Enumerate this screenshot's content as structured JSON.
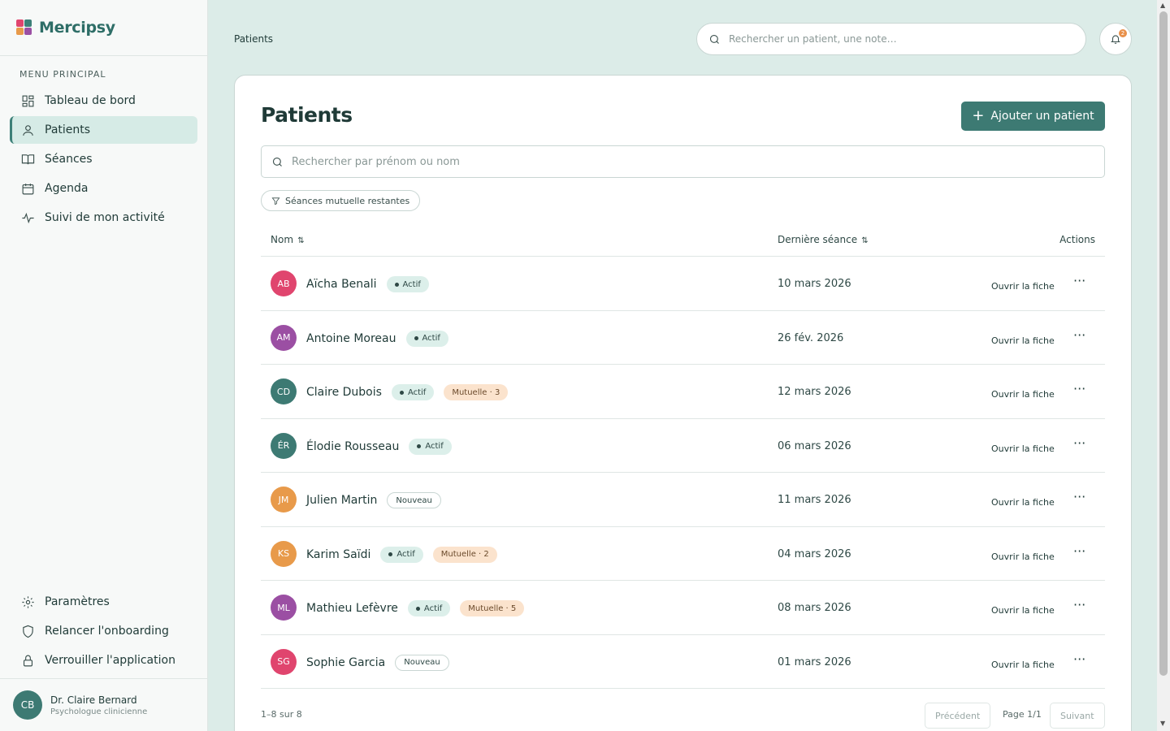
{
  "app": {
    "name": "Mercipsy"
  },
  "sidebar": {
    "menu_label": "MENU PRINCIPAL",
    "items": [
      {
        "label": "Tableau de bord",
        "icon": "dashboard-icon"
      },
      {
        "label": "Patients",
        "icon": "user-icon",
        "active": true
      },
      {
        "label": "Séances",
        "icon": "book-icon"
      },
      {
        "label": "Agenda",
        "icon": "calendar-icon"
      },
      {
        "label": "Suivi de mon activité",
        "icon": "activity-icon"
      }
    ],
    "bottom_items": [
      {
        "label": "Paramètres",
        "icon": "gear-icon"
      },
      {
        "label": "Relancer l'onboarding",
        "icon": "shield-icon"
      },
      {
        "label": "Verrouiller l'application",
        "icon": "lock-icon"
      }
    ],
    "user": {
      "initials": "CB",
      "name": "Dr. Claire Bernard",
      "role": "Psychologue clinicienne"
    }
  },
  "header": {
    "breadcrumb": "Patients",
    "search_placeholder": "Rechercher un patient, une note…",
    "notifications_count": "2"
  },
  "main": {
    "title": "Patients",
    "add_button": "Ajouter un patient",
    "search_placeholder": "Rechercher par prénom ou nom",
    "filter_label": "Séances mutuelle restantes",
    "columns": {
      "name": "Nom",
      "last_session": "Dernière séance",
      "actions": "Actions"
    },
    "open_label": "Ouvrir la fiche",
    "patients": [
      {
        "initials": "AB",
        "name": "Aïcha Benali",
        "status": "Actif",
        "mutuelle": "",
        "date": "10 mars 2026",
        "color": "#e0456e"
      },
      {
        "initials": "AM",
        "name": "Antoine Moreau",
        "status": "Actif",
        "mutuelle": "",
        "date": "26 fév. 2026",
        "color": "#9b4fa3"
      },
      {
        "initials": "CD",
        "name": "Claire Dubois",
        "status": "Actif",
        "mutuelle": "Mutuelle · 3",
        "date": "12 mars 2026",
        "color": "#3d7a73"
      },
      {
        "initials": "ÉR",
        "name": "Élodie Rousseau",
        "status": "Actif",
        "mutuelle": "",
        "date": "06 mars 2026",
        "color": "#3d7a73"
      },
      {
        "initials": "JM",
        "name": "Julien Martin",
        "status": "Nouveau",
        "mutuelle": "",
        "date": "11 mars 2026",
        "color": "#e89a4a"
      },
      {
        "initials": "KS",
        "name": "Karim Saïdi",
        "status": "Actif",
        "mutuelle": "Mutuelle · 2",
        "date": "04 mars 2026",
        "color": "#e89a4a"
      },
      {
        "initials": "ML",
        "name": "Mathieu Lefèvre",
        "status": "Actif",
        "mutuelle": "Mutuelle · 5",
        "date": "08 mars 2026",
        "color": "#9b4fa3"
      },
      {
        "initials": "SG",
        "name": "Sophie Garcia",
        "status": "Nouveau",
        "mutuelle": "",
        "date": "01 mars 2026",
        "color": "#e0456e"
      }
    ],
    "pagination": {
      "info": "1–8 sur 8",
      "prev": "Précédent",
      "page": "Page 1/1",
      "next": "Suivant"
    }
  }
}
